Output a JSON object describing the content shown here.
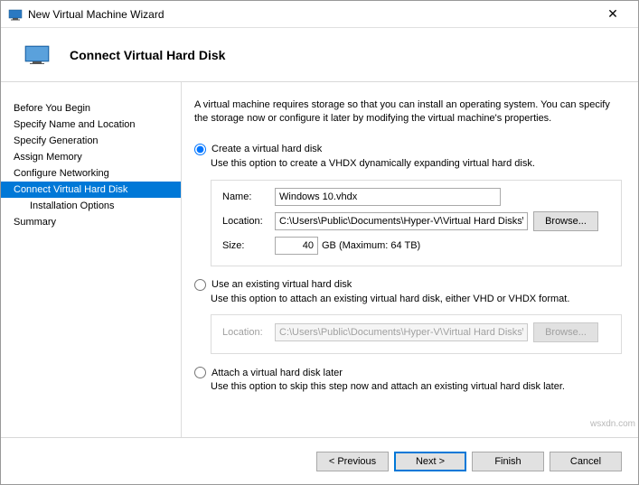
{
  "window": {
    "title": "New Virtual Machine Wizard",
    "close": "✕"
  },
  "header": {
    "headline": "Connect Virtual Hard Disk"
  },
  "nav": {
    "items": [
      {
        "label": "Before You Begin"
      },
      {
        "label": "Specify Name and Location"
      },
      {
        "label": "Specify Generation"
      },
      {
        "label": "Assign Memory"
      },
      {
        "label": "Configure Networking"
      },
      {
        "label": "Connect Virtual Hard Disk"
      },
      {
        "label": "Installation Options"
      },
      {
        "label": "Summary"
      }
    ]
  },
  "content": {
    "intro": "A virtual machine requires storage so that you can install an operating system. You can specify the storage now or configure it later by modifying the virtual machine's properties.",
    "opt_create": {
      "title": "Create a virtual hard disk",
      "sub": "Use this option to create a VHDX dynamically expanding virtual hard disk.",
      "name_label": "Name:",
      "name_value": "Windows 10.vhdx",
      "loc_label": "Location:",
      "loc_value": "C:\\Users\\Public\\Documents\\Hyper-V\\Virtual Hard Disks\\",
      "browse": "Browse...",
      "size_label": "Size:",
      "size_value": "40",
      "size_suffix": "GB (Maximum: 64 TB)"
    },
    "opt_existing": {
      "title": "Use an existing virtual hard disk",
      "sub": "Use this option to attach an existing virtual hard disk, either VHD or VHDX format.",
      "loc_label": "Location:",
      "loc_value": "C:\\Users\\Public\\Documents\\Hyper-V\\Virtual Hard Disks\\",
      "browse": "Browse..."
    },
    "opt_later": {
      "title": "Attach a virtual hard disk later",
      "sub": "Use this option to skip this step now and attach an existing virtual hard disk later."
    }
  },
  "footer": {
    "previous": "< Previous",
    "next": "Next >",
    "finish": "Finish",
    "cancel": "Cancel"
  },
  "watermark": "wsxdn.com"
}
